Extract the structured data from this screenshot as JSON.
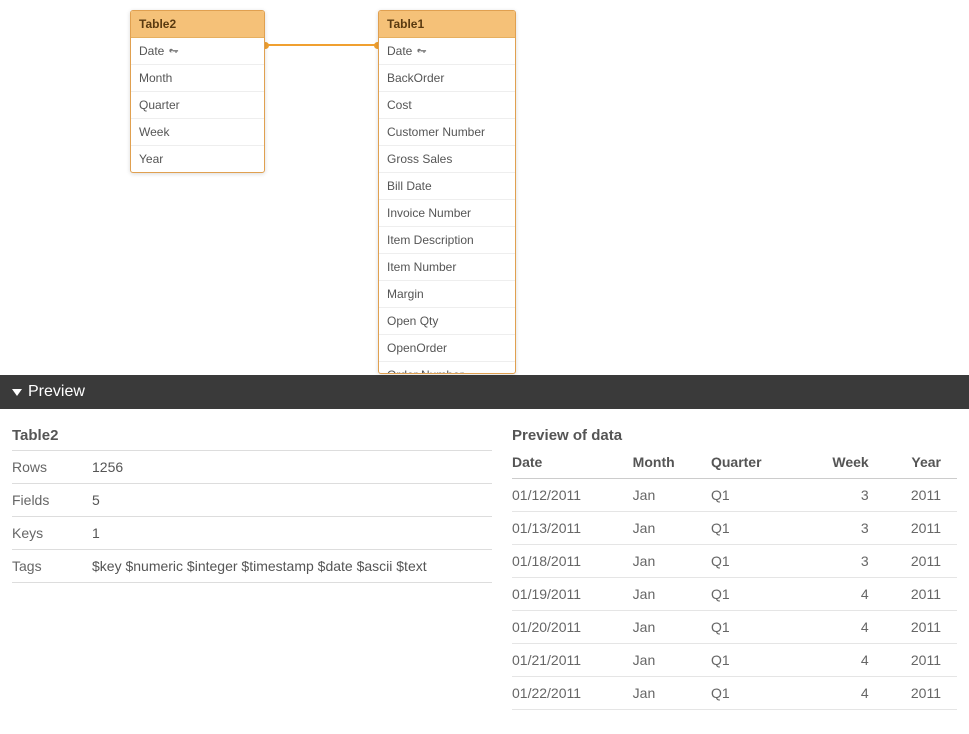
{
  "canvas": {
    "table2": {
      "title": "Table2",
      "fields": [
        "Date",
        "Month",
        "Quarter",
        "Week",
        "Year"
      ],
      "keyField": "Date"
    },
    "table1": {
      "title": "Table1",
      "fields": [
        "Date",
        "BackOrder",
        "Cost",
        "Customer Number",
        "Gross Sales",
        "Bill Date",
        "Invoice Number",
        "Item Description",
        "Item Number",
        "Margin",
        "Open Qty",
        "OpenOrder",
        "Order Number"
      ],
      "keyField": "Date"
    }
  },
  "previewBar": {
    "label": "Preview"
  },
  "meta": {
    "title": "Table2",
    "rows": [
      {
        "label": "Rows",
        "value": "1256"
      },
      {
        "label": "Fields",
        "value": "5"
      },
      {
        "label": "Keys",
        "value": "1"
      },
      {
        "label": "Tags",
        "value": "$key $numeric $integer $timestamp $date $ascii $text"
      }
    ]
  },
  "preview": {
    "title": "Preview of data",
    "columns": [
      "Date",
      "Month",
      "Quarter",
      "Week",
      "Year"
    ],
    "numericCols": [
      "Week",
      "Year"
    ],
    "rows": [
      {
        "Date": "01/12/2011",
        "Month": "Jan",
        "Quarter": "Q1",
        "Week": "3",
        "Year": "2011"
      },
      {
        "Date": "01/13/2011",
        "Month": "Jan",
        "Quarter": "Q1",
        "Week": "3",
        "Year": "2011"
      },
      {
        "Date": "01/18/2011",
        "Month": "Jan",
        "Quarter": "Q1",
        "Week": "3",
        "Year": "2011"
      },
      {
        "Date": "01/19/2011",
        "Month": "Jan",
        "Quarter": "Q1",
        "Week": "4",
        "Year": "2011"
      },
      {
        "Date": "01/20/2011",
        "Month": "Jan",
        "Quarter": "Q1",
        "Week": "4",
        "Year": "2011"
      },
      {
        "Date": "01/21/2011",
        "Month": "Jan",
        "Quarter": "Q1",
        "Week": "4",
        "Year": "2011"
      },
      {
        "Date": "01/22/2011",
        "Month": "Jan",
        "Quarter": "Q1",
        "Week": "4",
        "Year": "2011"
      }
    ]
  }
}
